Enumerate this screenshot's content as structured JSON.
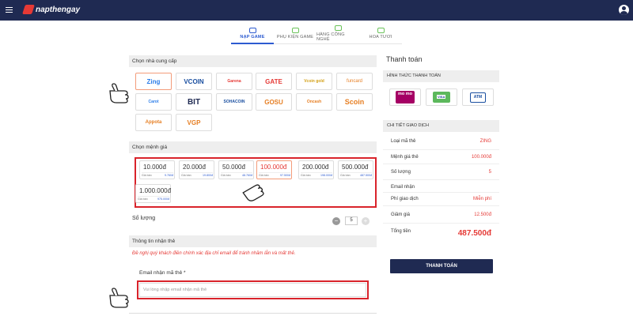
{
  "header": {
    "brand": "napthengay"
  },
  "tabs": [
    {
      "label": "NẠP GAME",
      "active": true
    },
    {
      "label": "PHỤ KIỆN GAME",
      "active": false
    },
    {
      "label": "HÀNG CÔNG NGHỆ",
      "active": false
    },
    {
      "label": "HOA TƯƠI",
      "active": false
    }
  ],
  "providers_section": {
    "title": "Chọn nhà cung cấp",
    "items": [
      "Zing",
      "VCOIN",
      "Garena",
      "GATE",
      "Vcoin gold",
      "funcard",
      "Carot",
      "BIT",
      "SOHACOIN",
      "GOSU",
      "Oncash",
      "Scoin",
      "Appota",
      "VGP"
    ],
    "selected": "Zing"
  },
  "denominations_section": {
    "title": "Chọn mệnh giá",
    "price_label": "Giá bán",
    "items": [
      {
        "value": "10.000đ",
        "price": "9.760đ"
      },
      {
        "value": "20.000đ",
        "price": "19.800đ"
      },
      {
        "value": "50.000đ",
        "price": "48.760đ"
      },
      {
        "value": "100.000đ",
        "price": "97.500đ",
        "selected": true
      },
      {
        "value": "200.000đ",
        "price": "198.000đ"
      },
      {
        "value": "500.000đ",
        "price": "487.500đ"
      },
      {
        "value": "1.000.000đ",
        "price": "975.000đ"
      }
    ]
  },
  "quantity": {
    "label": "Số lượng",
    "value": "5",
    "minus": "−",
    "plus": "+"
  },
  "receiver_section": {
    "title": "Thông tin nhận thẻ",
    "notice": "Đề nghị quý khách điền chính xác địa chỉ email để tránh nhầm lẫn và mất thẻ.",
    "email_label": "Email nhận mã thẻ *",
    "email_placeholder": "Vui lòng nhập email nhận mã thẻ"
  },
  "payment": {
    "title": "Thanh toán",
    "method_title": "HÌNH THỨC THANH TOÁN",
    "methods": [
      "mo mo",
      "VISA",
      "ATM"
    ],
    "detail_title": "CHI TIẾT GIAO DỊCH",
    "rows": [
      {
        "label": "Loại mã thẻ",
        "value": "ZING"
      },
      {
        "label": "Mệnh giá thẻ",
        "value": "100.000đ"
      },
      {
        "label": "Số lượng",
        "value": "5"
      },
      {
        "label": "Email nhận",
        "value": ""
      },
      {
        "label": "Phí giao dịch",
        "value": "Miễn phí"
      },
      {
        "label": "Giảm giá",
        "value": "12.500đ"
      }
    ],
    "total_label": "Tổng tiền",
    "total_value": "487.500đ",
    "button": "THANH TOÁN"
  },
  "colors": {
    "navy": "#1f2a52",
    "accent_red": "#e53935",
    "highlight_box": "#d9232b",
    "tab_active": "#2d5bd0"
  }
}
